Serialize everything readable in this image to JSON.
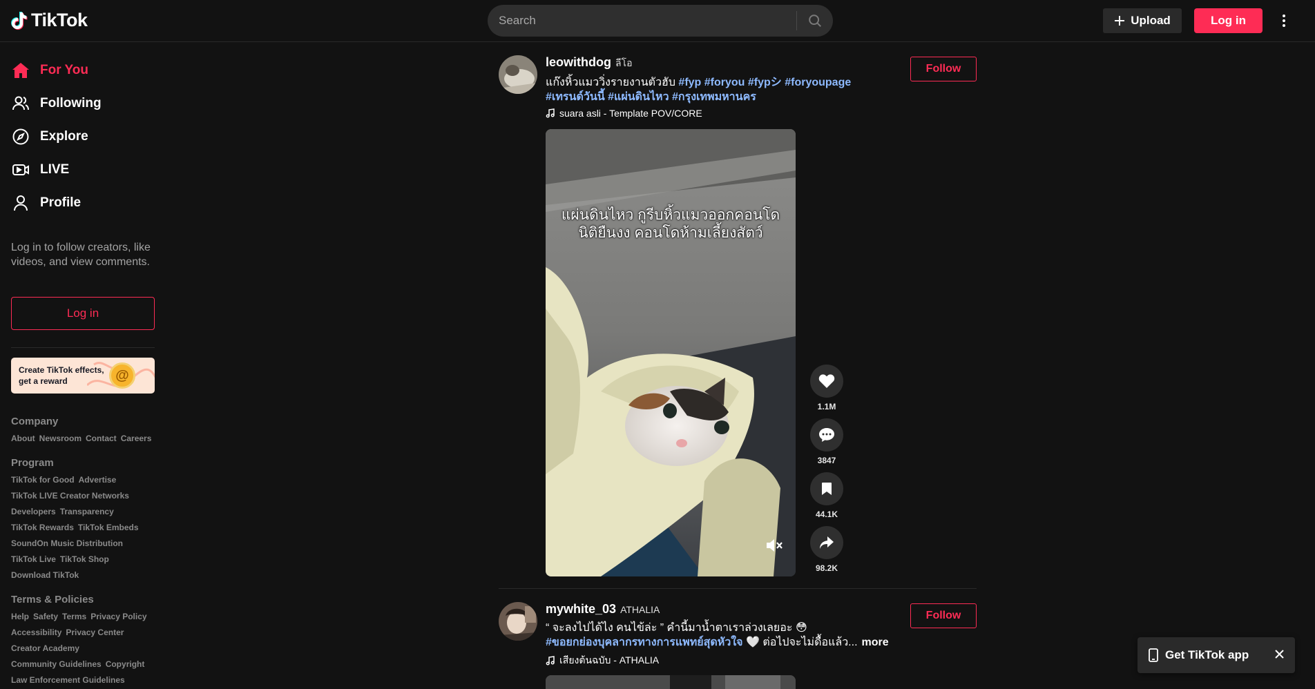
{
  "header": {
    "logo_text": "TikTok",
    "search_placeholder": "Search",
    "upload_label": "Upload",
    "login_label": "Log in"
  },
  "sidebar": {
    "nav": [
      {
        "label": "For You",
        "icon": "home-icon",
        "active": true
      },
      {
        "label": "Following",
        "icon": "users-icon"
      },
      {
        "label": "Explore",
        "icon": "compass-icon"
      },
      {
        "label": "LIVE",
        "icon": "live-icon"
      },
      {
        "label": "Profile",
        "icon": "person-icon"
      }
    ],
    "login_prompt": "Log in to follow creators, like videos, and view comments.",
    "login_label": "Log in",
    "effects_banner": "Create TikTok effects, get a reward",
    "footer": {
      "company_title": "Company",
      "company_links": [
        "About",
        "Newsroom",
        "Contact",
        "Careers"
      ],
      "program_title": "Program",
      "program_links": [
        "TikTok for Good",
        "Advertise",
        "TikTok LIVE Creator Networks",
        "Developers",
        "Transparency",
        "TikTok Rewards",
        "TikTok Embeds",
        "SoundOn Music Distribution",
        "TikTok Live",
        "TikTok Shop",
        "Download TikTok"
      ],
      "terms_title": "Terms & Policies",
      "terms_links": [
        "Help",
        "Safety",
        "Terms",
        "Privacy Policy",
        "Accessibility",
        "Privacy Center",
        "Creator Academy",
        "Community Guidelines",
        "Copyright",
        "Law Enforcement Guidelines"
      ]
    }
  },
  "posts": [
    {
      "username": "leowithdog",
      "nickname": "ลีโอ",
      "caption_text": "แก๊งหิ้วแมววิ่งรายงานตัวฮับ ",
      "tags_line1": "#fyp #foryou #fypシ #foryoupage",
      "tags_line2": "#เทรนด์วันนี้ #แผ่นดินไหว #กรุงเทพมหานคร",
      "music": "suara asli - Template POV/CORE",
      "follow_label": "Follow",
      "overlay_line1": "แผ่นดินไหว กูรีบหิ้วแมวออกคอนโด",
      "overlay_line2": "นิติยืนงง คอนโดห้ามเลี้ยงสัตว์",
      "likes": "1.1M",
      "comments": "3847",
      "saves": "44.1K",
      "shares": "98.2K"
    },
    {
      "username": "mywhite_03",
      "nickname": "ATHALIA",
      "caption_line1": "“ จะลงไปได้ไง คนไข้ล่ะ ” คำนี้มาน้ำตาเราล่วงเลยอะ 😳",
      "caption_tag": "#ขอยกย่องบุคลากรทางการแพทย์สุดหัวใจ",
      "caption_rest": " 🤍 ต่อไปจะไม่ดื้อแล้ว...",
      "more_label": "more",
      "music": "เสียงต้นฉบับ - ATHALIA",
      "follow_label": "Follow"
    }
  ],
  "get_app_label": "Get TikTok app",
  "colors": {
    "accent": "#fe2c55",
    "background": "#121212",
    "tag": "#8ebaff"
  }
}
